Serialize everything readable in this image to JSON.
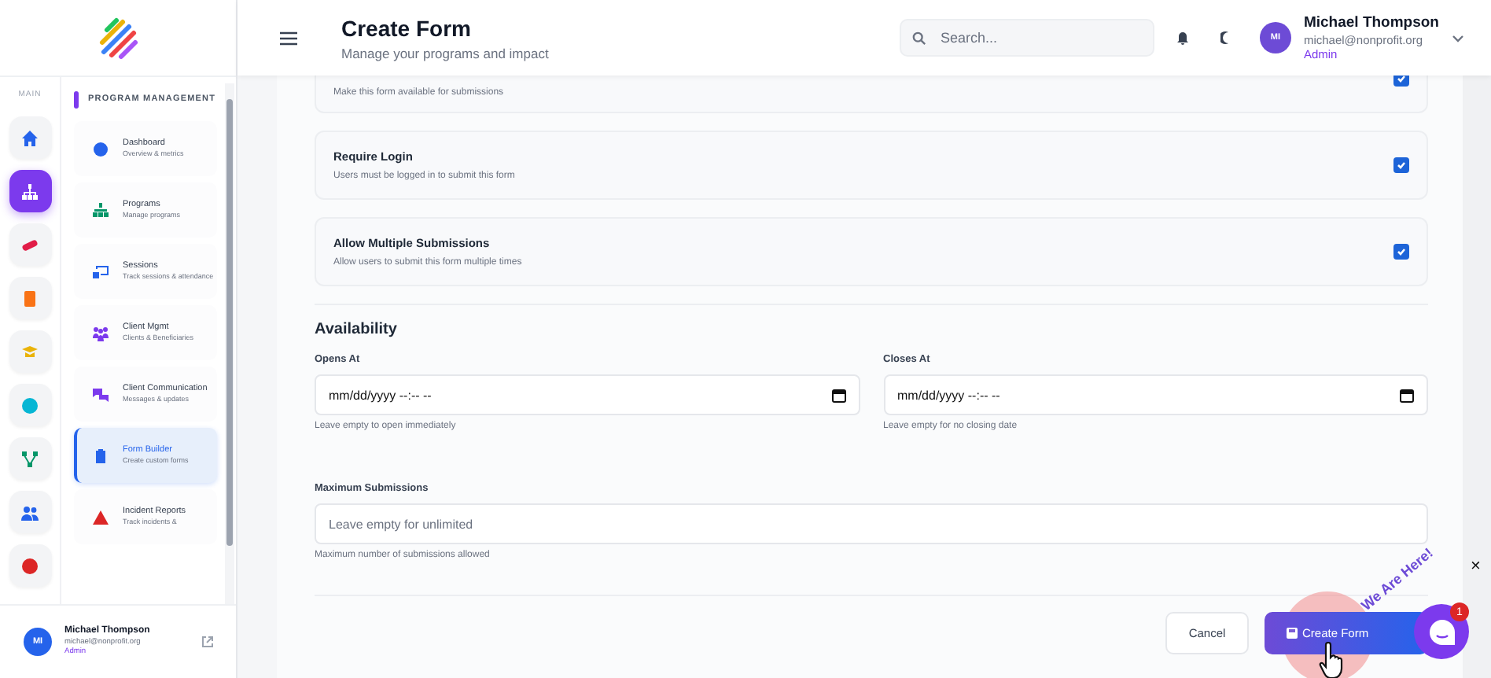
{
  "rail": {
    "label": "MAIN",
    "items": [
      {
        "selected": false
      },
      {
        "selected": true
      },
      {
        "selected": false
      },
      {
        "selected": false
      },
      {
        "selected": false
      },
      {
        "selected": false
      },
      {
        "selected": false
      },
      {
        "selected": false
      },
      {
        "selected": false
      }
    ]
  },
  "nav": {
    "section": "PROGRAM MANAGEMENT",
    "items": [
      {
        "title": "Dashboard",
        "subtitle": "Overview & metrics",
        "selected": false
      },
      {
        "title": "Programs",
        "subtitle": "Manage programs",
        "selected": false
      },
      {
        "title": "Sessions",
        "subtitle": "Track sessions & attendance",
        "selected": false
      },
      {
        "title": "Client Mgmt",
        "subtitle": "Clients & Beneficiaries",
        "selected": false
      },
      {
        "title": "Client Communication",
        "subtitle": "Messages & updates",
        "selected": false
      },
      {
        "title": "Form Builder",
        "subtitle": "Create custom forms",
        "selected": true
      },
      {
        "title": "Incident Reports",
        "subtitle": "Track incidents &",
        "selected": false
      }
    ]
  },
  "sidebar_user": {
    "initials": "MI",
    "name": "Michael Thompson",
    "email": "michael@nonprofit.org",
    "role": "Admin"
  },
  "header": {
    "title": "Create Form",
    "subtitle": "Manage your programs and impact",
    "search_placeholder": "Search...",
    "user": {
      "initials": "MI",
      "name": "Michael Thompson",
      "email": "michael@nonprofit.org",
      "role": "Admin"
    }
  },
  "settings": [
    {
      "description": "Make this form available for submissions",
      "checked": true
    },
    {
      "title": "Require Login",
      "description": "Users must be logged in to submit this form",
      "checked": true
    },
    {
      "title": "Allow Multiple Submissions",
      "description": "Allow users to submit this form multiple times",
      "checked": true
    }
  ],
  "availability": {
    "heading": "Availability",
    "fields": [
      {
        "label": "Opens At",
        "value": "mm/dd/yyyy --:-- --",
        "hint": "Leave empty to open immediately"
      },
      {
        "label": "Closes At",
        "value": "mm/dd/yyyy --:-- --",
        "hint": "Leave empty for no closing date"
      }
    ],
    "max": {
      "label": "Maximum Submissions",
      "placeholder": "Leave empty for unlimited",
      "hint": "Maximum number of submissions allowed"
    }
  },
  "buttons": {
    "cancel": "Cancel",
    "submit": "Create Form"
  },
  "chat": {
    "banner": "We Are Here!",
    "badge": "1",
    "close": "×"
  }
}
